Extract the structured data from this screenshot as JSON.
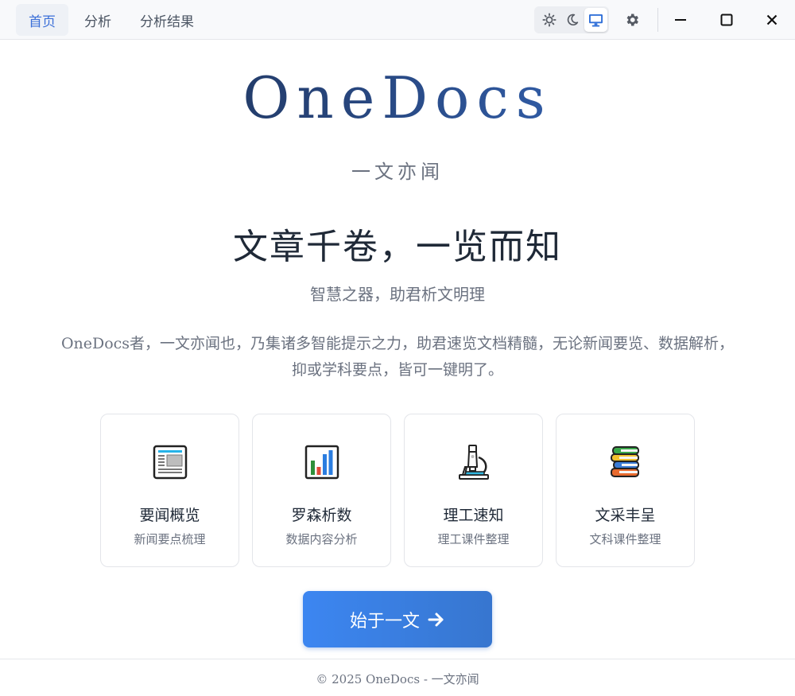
{
  "nav": {
    "tabs": [
      {
        "label": "首页",
        "active": true
      },
      {
        "label": "分析",
        "active": false
      },
      {
        "label": "分析结果",
        "active": false
      }
    ]
  },
  "toolbar": {
    "theme_options": [
      "sun-icon",
      "moon-icon",
      "monitor-icon"
    ],
    "active_theme": "monitor-icon",
    "settings_icon": "gear-icon",
    "window_controls": [
      "minimize-icon",
      "maximize-icon",
      "close-icon"
    ]
  },
  "hero": {
    "logo": "OneDocs",
    "tagline": "一文亦闻",
    "headline": "文章千卷，一览而知",
    "subhead": "智慧之器，助君析文明理",
    "description": "OneDocs者，一文亦闻也，乃集诸多智能提示之力，助君速览文档精髓，无论新闻要览、数据解析，抑或学科要点，皆可一键明了。"
  },
  "cards": [
    {
      "icon": "newspaper-icon",
      "title": "要闻概览",
      "subtitle": "新闻要点梳理"
    },
    {
      "icon": "bar-chart-icon",
      "title": "罗森析数",
      "subtitle": "数据内容分析"
    },
    {
      "icon": "microscope-icon",
      "title": "理工速知",
      "subtitle": "理工课件整理"
    },
    {
      "icon": "books-icon",
      "title": "文采丰呈",
      "subtitle": "文科课件整理"
    }
  ],
  "cta": {
    "label": "始于一文",
    "icon": "arrow-right-icon"
  },
  "footer": {
    "text": "© 2025 OneDocs - 一文亦闻"
  },
  "colors": {
    "accent": "#3b6fd8",
    "button": "#3c86f1",
    "text": "#1f2937",
    "muted": "#6b7280"
  }
}
